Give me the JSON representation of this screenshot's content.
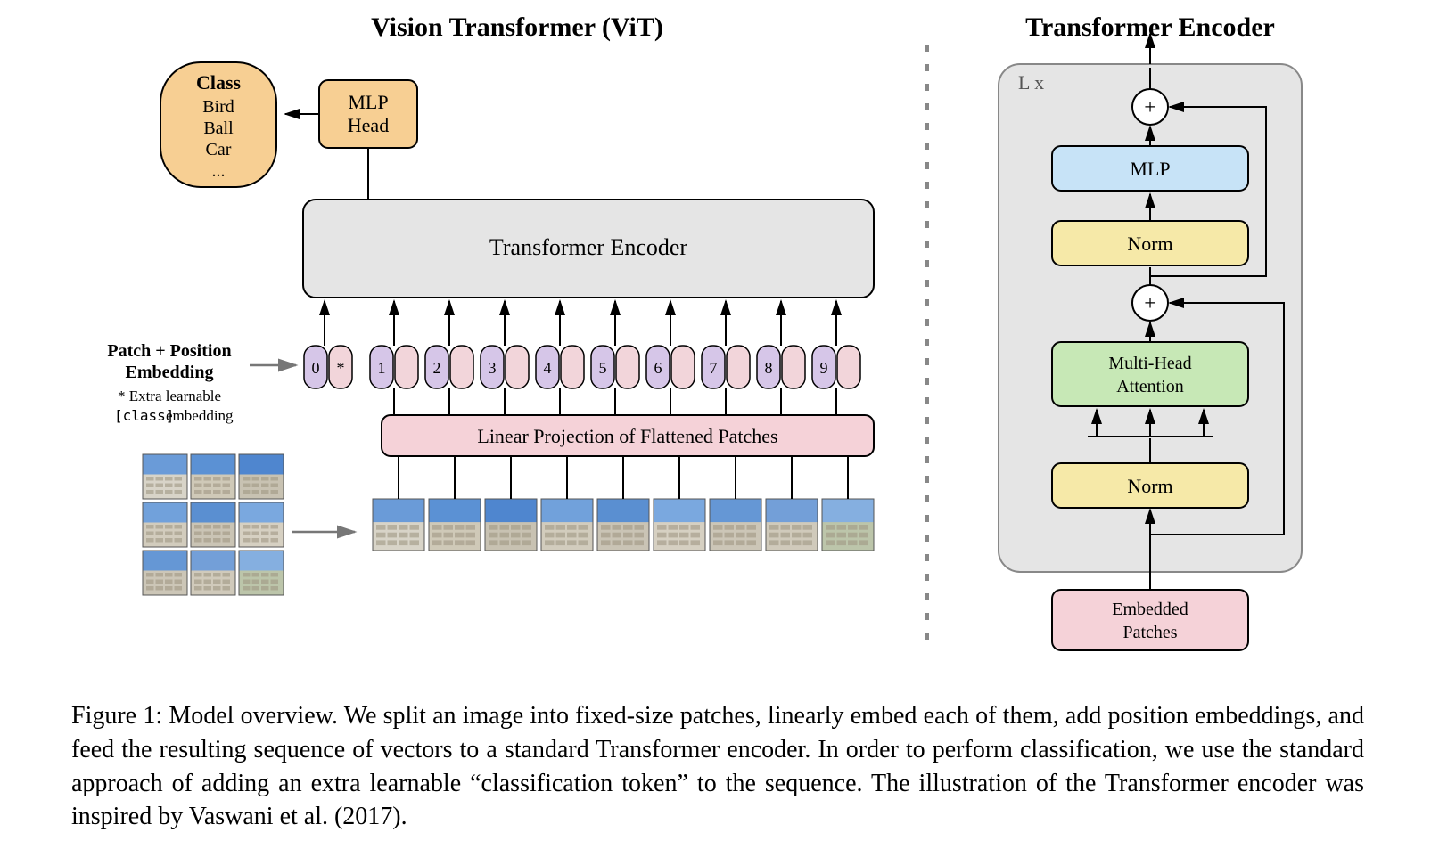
{
  "left": {
    "title": "Vision Transformer (ViT)",
    "classBox": {
      "header": "Class",
      "items": [
        "Bird",
        "Ball",
        "Car",
        "..."
      ]
    },
    "mlpHead": "MLP\nHead",
    "encoder": "Transformer Encoder",
    "embedLabelLine1": "Patch + Position",
    "embedLabelLine2": "Embedding",
    "embedNoteLine1": "* Extra learnable",
    "embedNoteLine2": "[class]",
    "embedNoteLine3": " embedding",
    "tokens": [
      "0",
      "*",
      "1",
      "2",
      "3",
      "4",
      "5",
      "6",
      "7",
      "8",
      "9"
    ],
    "linearProj": "Linear Projection of Flattened Patches",
    "patchCount": 9
  },
  "right": {
    "title": "Transformer Encoder",
    "lx": "L x",
    "mlp": "MLP",
    "norm": "Norm",
    "mha": "Multi-Head\nAttention",
    "embedded": "Embedded\nPatches",
    "plus": "+"
  },
  "caption": "Figure 1: Model overview. We split an image into fixed-size patches, linearly embed each of them, add position embeddings, and feed the resulting sequence of vectors to a standard Transformer encoder. In order to perform classification, we use the standard approach of adding an extra learnable “classification token” to the sequence. The illustration of the Transformer encoder was inspired by Vaswani et al. (2017).",
  "patchColors": [
    {
      "sky": "#6a9bd8",
      "bldg": "#d8d4c8"
    },
    {
      "sky": "#5b91d4",
      "bldg": "#cfc9b8"
    },
    {
      "sky": "#4f86cf",
      "bldg": "#c8c2b2"
    },
    {
      "sky": "#71a1db",
      "bldg": "#d2ccbd"
    },
    {
      "sky": "#5a8fd1",
      "bldg": "#cac4b5"
    },
    {
      "sky": "#7aa8df",
      "bldg": "#d6d0c2"
    },
    {
      "sky": "#6597d5",
      "bldg": "#ccc6b7"
    },
    {
      "sky": "#739fd8",
      "bldg": "#d0cabb"
    },
    {
      "sky": "#85afe0",
      "bldg": "#bcc5aa"
    }
  ]
}
